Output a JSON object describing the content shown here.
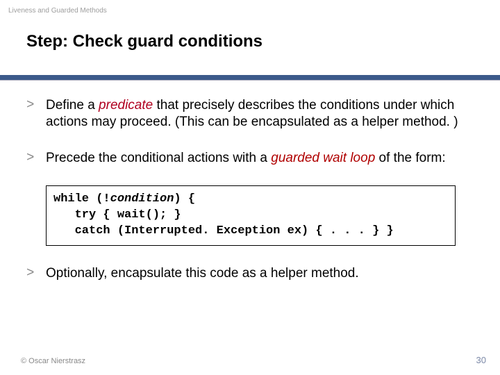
{
  "topic": "Liveness and Guarded Methods",
  "title": "Step: Check guard conditions",
  "bullets": {
    "b1_gt": ">",
    "b1_pre": "Define a ",
    "b1_pred": "predicate",
    "b1_post": " that precisely describes the conditions under which actions may proceed. (This can be encapsulated as a helper method. )",
    "b2_gt": ">",
    "b2_pre": "Precede the conditional actions with a ",
    "b2_gwl": "guarded wait loop",
    "b2_post": " of the form:",
    "b3_gt": ">",
    "b3_txt": "Optionally, encapsulate this code as a helper method."
  },
  "code": {
    "l1a": "while (!",
    "l1_cond": "condition",
    "l1b": ") {",
    "l2": "   try { wait(); }",
    "l3": "   catch (Interrupted. Exception ex) { . . . } }"
  },
  "footer": {
    "left": "© Oscar Nierstrasz",
    "right": "30"
  }
}
